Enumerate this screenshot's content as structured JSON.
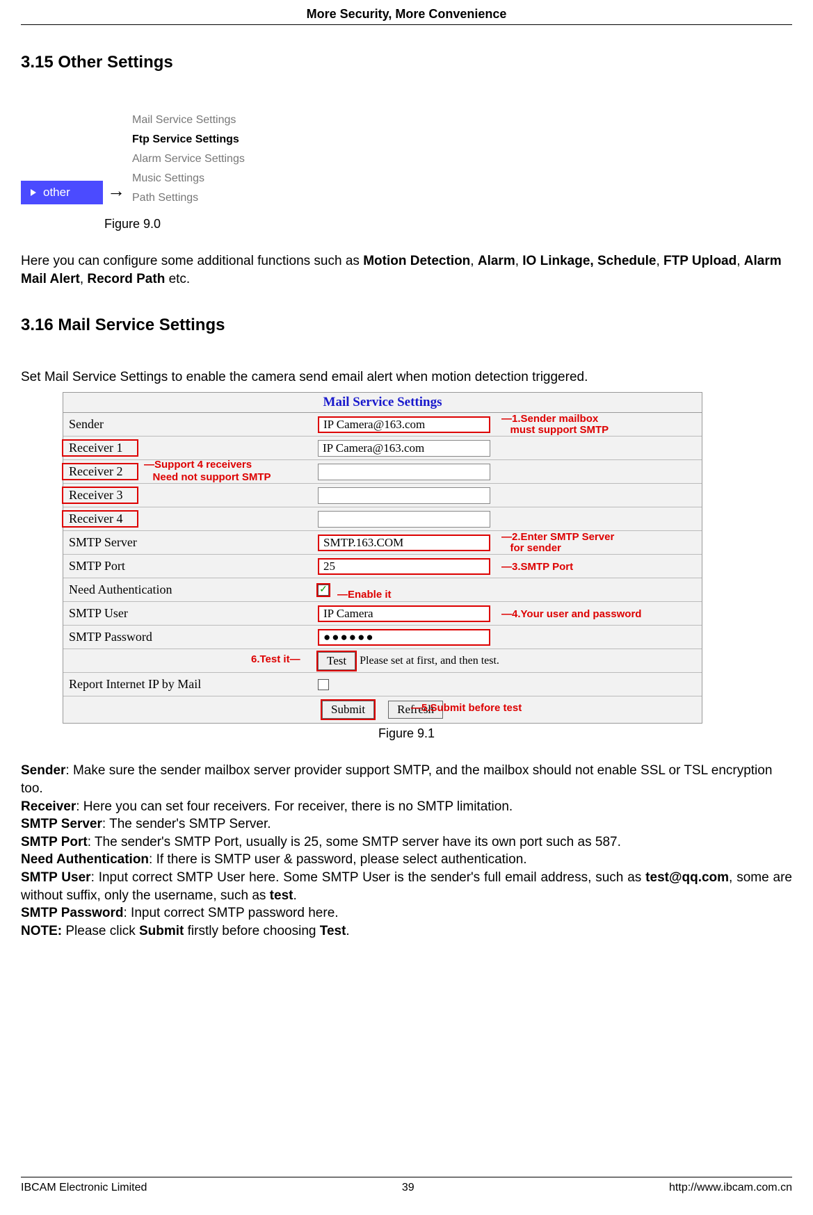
{
  "header": {
    "title": "More Security, More Convenience"
  },
  "sec315": {
    "heading": "3.15 Other Settings",
    "other_tab": "other",
    "arrow": "→",
    "menu": {
      "mail": "Mail Service Settings",
      "ftp": "Ftp Service Settings",
      "alarm": "Alarm Service Settings",
      "music": "Music Settings",
      "path": "Path Settings"
    },
    "caption": "Figure 9.0",
    "para_pre": "Here you can configure some additional functions such as ",
    "b1": "Motion Detection",
    "c1": ", ",
    "b2": "Alarm",
    "c2": ", ",
    "b3": "IO Linkage, Schedule",
    "c3": ", ",
    "b4": "FTP Upload",
    "c4": ", ",
    "b5": "Alarm Mail Alert",
    "c5": ", ",
    "b6": "Record Path",
    "para_end": " etc."
  },
  "sec316": {
    "heading": "3.16 Mail Service Settings",
    "set_pre": "Set ",
    "set_b": "Mail Service Settings",
    "set_post": " to enable the camera send email alert when motion detection triggered."
  },
  "mail": {
    "title": "Mail Service Settings",
    "rows": {
      "sender": {
        "label": "Sender",
        "value": "IP Camera@163.com"
      },
      "r1": {
        "label": "Receiver 1",
        "value": "IP Camera@163.com"
      },
      "r2": {
        "label": "Receiver 2",
        "value": ""
      },
      "r3": {
        "label": "Receiver 3",
        "value": ""
      },
      "r4": {
        "label": "Receiver 4",
        "value": ""
      },
      "server": {
        "label": "SMTP Server",
        "value": "SMTP.163.COM"
      },
      "port": {
        "label": "SMTP Port",
        "value": "25"
      },
      "auth": {
        "label": "Need Authentication",
        "checked": "✓"
      },
      "user": {
        "label": "SMTP User",
        "value": "IP Camera"
      },
      "pass": {
        "label": "SMTP Password",
        "value": "●●●●●●"
      },
      "test": {
        "btn": "Test",
        "hint": "Please set at first, and then test."
      },
      "report": {
        "label": "Report Internet IP by Mail"
      }
    },
    "submit": "Submit",
    "refresh": "Refresh",
    "annot": {
      "a1a": "1.Sender mailbox",
      "a1b": "must support SMTP",
      "a2a": "Support 4 receivers",
      "a2b": "Need not support SMTP",
      "a3a": "2.Enter SMTP Server",
      "a3b": "for sender",
      "a4": "3.SMTP Port",
      "a5": "Enable it",
      "a6": "4.Your user and password",
      "a7": "6.Test it",
      "a8": "5.Submit before test"
    },
    "caption": "Figure 9.1"
  },
  "defs": {
    "d1b": "Sender",
    "d1": ": Make sure the sender mailbox server provider support SMTP, and the mailbox should not enable SSL or TSL encryption too.",
    "d2b": "Receiver",
    "d2": ": Here you can set four receivers. For receiver, there is no SMTP limitation.",
    "d3b": "SMTP Server",
    "d3": ": The sender's SMTP Server.",
    "d4b": "SMTP Port",
    "d4": ": The sender's SMTP Port, usually is 25, some SMTP server have its own port such as 587.",
    "d5b": "Need Authentication",
    "d5": ": If there is SMTP user & password, please select authentication.",
    "d6b": "SMTP User",
    "d6a": ": Input correct SMTP User here. Some SMTP User is the sender's full email address, such as ",
    "d6c": "test@qq.com",
    "d6d": ", some are without suffix, only the username, such as ",
    "d6e": "test",
    "d6f": ".",
    "d7b": "SMTP Password",
    "d7": ": Input correct SMTP password here.",
    "d8b": "NOTE:",
    "d8a": " Please click ",
    "d8c": "Submit",
    "d8d": " firstly before choosing ",
    "d8e": "Test",
    "d8f": "."
  },
  "footer": {
    "left": "IBCAM Electronic Limited",
    "center": "39",
    "right": "http://www.ibcam.com.cn"
  }
}
